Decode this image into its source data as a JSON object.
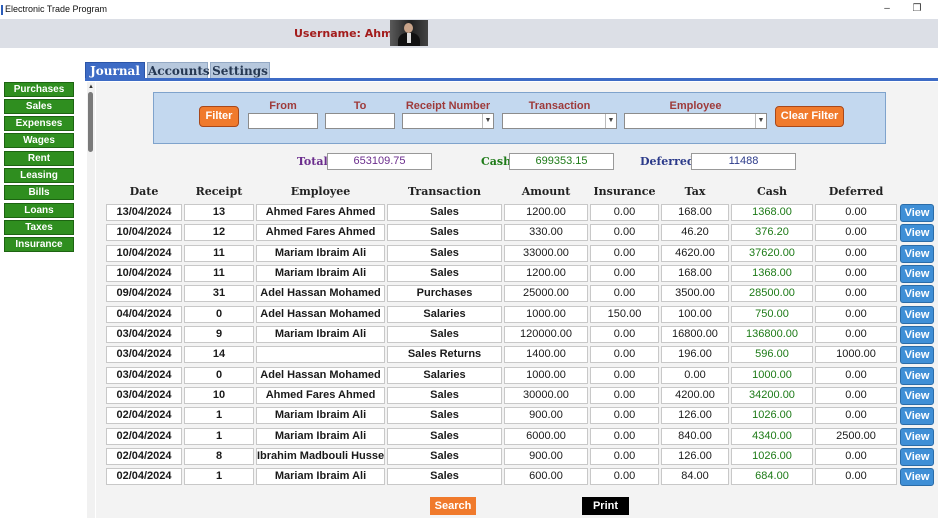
{
  "window": {
    "title": "Electronic Trade Program",
    "minimize_glyph": "–",
    "restore_glyph": "❐"
  },
  "header": {
    "username_label": "Username: Ahmed"
  },
  "tabs": [
    {
      "label": "Journal"
    },
    {
      "label": "Accounts"
    },
    {
      "label": "Settings"
    }
  ],
  "sidebar": {
    "items": [
      {
        "label": "Purchases"
      },
      {
        "label": "Sales"
      },
      {
        "label": "Expenses"
      },
      {
        "label": "Wages"
      },
      {
        "label": "Rent"
      },
      {
        "label": "Leasing"
      },
      {
        "label": "Bills"
      },
      {
        "label": "Loans"
      },
      {
        "label": "Taxes"
      },
      {
        "label": "Insurance"
      }
    ]
  },
  "filter": {
    "filter_button": "Filter",
    "clear_button": "Clear Filter",
    "labels": {
      "from": "From",
      "to": "To",
      "receipt_number": "Receipt Number",
      "transaction": "Transaction",
      "employee": "Employee"
    },
    "values": {
      "from": "",
      "to": "",
      "receipt_number": "",
      "transaction": "",
      "employee": ""
    }
  },
  "totals": {
    "total_label": "Total",
    "total_value": "653109.75",
    "cash_label": "Cash",
    "cash_value": "699353.15",
    "deferred_label": "Deferred",
    "deferred_value": "11488"
  },
  "table": {
    "columns": [
      "Date",
      "Receipt",
      "Employee",
      "Transaction",
      "Amount",
      "Insurance",
      "Tax",
      "Cash",
      "Deferred"
    ],
    "view_label": "View",
    "rows": [
      [
        "13/04/2024",
        "13",
        "Ahmed Fares Ahmed",
        "Sales",
        "1200.00",
        "0.00",
        "168.00",
        "1368.00",
        "0.00"
      ],
      [
        "10/04/2024",
        "12",
        "Ahmed Fares Ahmed",
        "Sales",
        "330.00",
        "0.00",
        "46.20",
        "376.20",
        "0.00"
      ],
      [
        "10/04/2024",
        "11",
        "Mariam Ibraim Ali",
        "Sales",
        "33000.00",
        "0.00",
        "4620.00",
        "37620.00",
        "0.00"
      ],
      [
        "10/04/2024",
        "11",
        "Mariam Ibraim Ali",
        "Sales",
        "1200.00",
        "0.00",
        "168.00",
        "1368.00",
        "0.00"
      ],
      [
        "09/04/2024",
        "31",
        "Adel Hassan Mohamed",
        "Purchases",
        "25000.00",
        "0.00",
        "3500.00",
        "28500.00",
        "0.00"
      ],
      [
        "04/04/2024",
        "0",
        "Adel Hassan Mohamed",
        "Salaries",
        "1000.00",
        "150.00",
        "100.00",
        "750.00",
        "0.00"
      ],
      [
        "03/04/2024",
        "9",
        "Mariam Ibraim Ali",
        "Sales",
        "120000.00",
        "0.00",
        "16800.00",
        "136800.00",
        "0.00"
      ],
      [
        "03/04/2024",
        "14",
        "",
        "Sales Returns",
        "1400.00",
        "0.00",
        "196.00",
        "596.00",
        "1000.00"
      ],
      [
        "03/04/2024",
        "0",
        "Adel Hassan Mohamed",
        "Salaries",
        "1000.00",
        "0.00",
        "0.00",
        "1000.00",
        "0.00"
      ],
      [
        "03/04/2024",
        "10",
        "Ahmed Fares Ahmed",
        "Sales",
        "30000.00",
        "0.00",
        "4200.00",
        "34200.00",
        "0.00"
      ],
      [
        "02/04/2024",
        "1",
        "Mariam Ibraim Ali",
        "Sales",
        "900.00",
        "0.00",
        "126.00",
        "1026.00",
        "0.00"
      ],
      [
        "02/04/2024",
        "1",
        "Mariam Ibraim Ali",
        "Sales",
        "6000.00",
        "0.00",
        "840.00",
        "4340.00",
        "2500.00"
      ],
      [
        "02/04/2024",
        "8",
        "Ibrahim Madbouli Hussein",
        "Sales",
        "900.00",
        "0.00",
        "126.00",
        "1026.00",
        "0.00"
      ],
      [
        "02/04/2024",
        "1",
        "Mariam Ibraim Ali",
        "Sales",
        "600.00",
        "0.00",
        "84.00",
        "684.00",
        "0.00"
      ]
    ]
  },
  "footer": {
    "search_button": "Search",
    "print_button": "Print"
  },
  "colors": {
    "tab_active": "#3d6bc5",
    "sidebar_green": "#2f8e1f",
    "orange": "#f07a2c",
    "view_blue": "#3f8fd6",
    "username_red": "#a31c1c",
    "cash_green": "#1d7a17",
    "total_purple": "#6a2c8c",
    "deferred_navy": "#2b3a8a"
  }
}
